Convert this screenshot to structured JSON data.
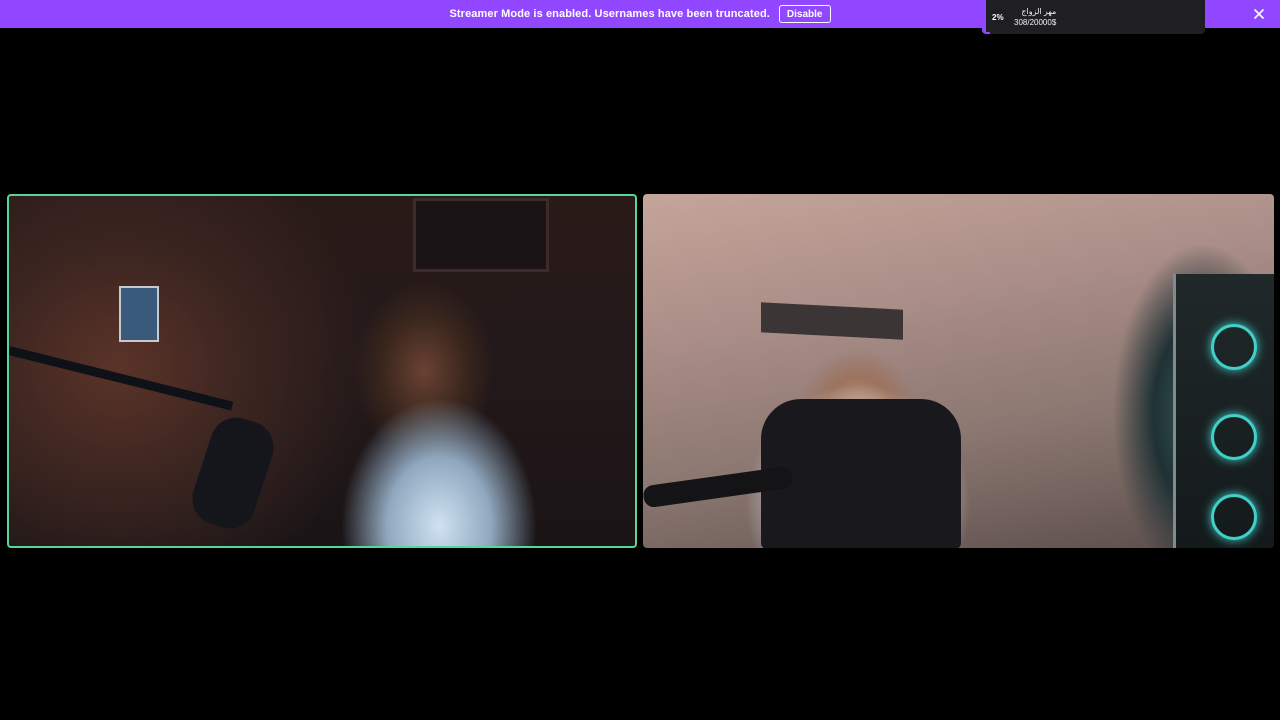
{
  "banner": {
    "message": "Streamer Mode is enabled. Usernames have been truncated.",
    "disable_label": "Disable",
    "close_icon": "close-icon",
    "background_color": "#9147ff"
  },
  "goal": {
    "percent_label": "2%",
    "progress_fraction": 0.02,
    "title": "مهر الزواج",
    "amount": "308/20000$"
  },
  "participants": {
    "left": {
      "active_speaker": true,
      "border_color": "#57d69a"
    },
    "right": {
      "active_speaker": false
    }
  }
}
